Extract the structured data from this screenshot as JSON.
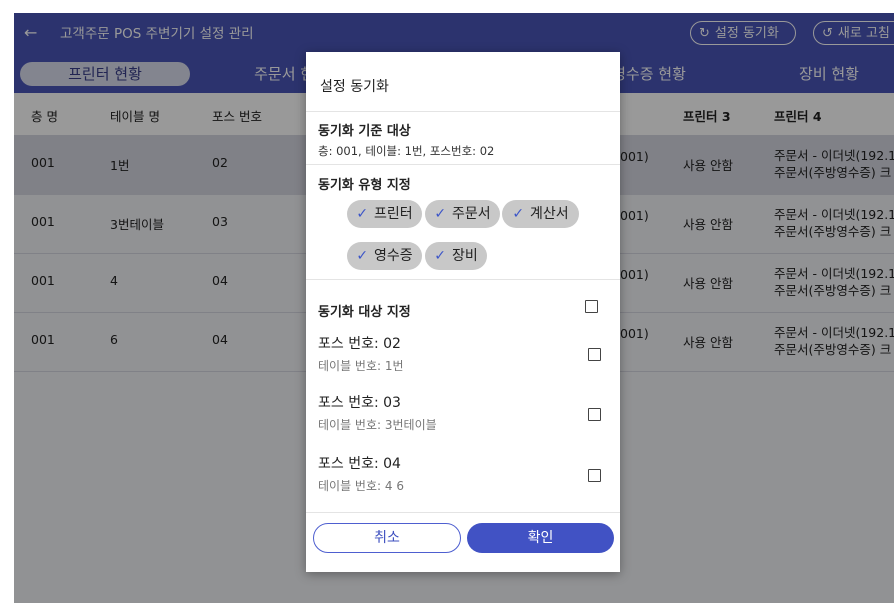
{
  "header": {
    "back_icon": "back-arrow-icon",
    "title": "고객주문 POS 주변기기 설정 관리",
    "sync_button": {
      "icon": "sync-icon",
      "label": "설정 동기화"
    },
    "refresh_button": {
      "icon": "refresh-icon",
      "label": "새로 고침"
    }
  },
  "tabs": [
    "프린터 현황",
    "주문서 현황",
    "영수증 현황",
    "장비 현황"
  ],
  "table": {
    "columns": [
      "층 명",
      "테이블 명",
      "포스 번호",
      "프린터 3",
      "프린터 4"
    ],
    "rows": [
      {
        "floor": "001",
        "table": "1번",
        "pos": "02",
        "partial": "001)",
        "printer3": "사용 안함",
        "printer4_line1": "주문서 - 이더넷(192.1",
        "printer4_line2": "주문서(주방영수증) 크"
      },
      {
        "floor": "001",
        "table": "3번테이블",
        "pos": "03",
        "partial": "001)",
        "printer3": "사용 안함",
        "printer4_line1": "주문서 - 이더넷(192.1",
        "printer4_line2": "주문서(주방영수증) 크"
      },
      {
        "floor": "001",
        "table": "4",
        "pos": "04",
        "partial": "001)",
        "printer3": "사용 안함",
        "printer4_line1": "주문서 - 이더넷(192.1",
        "printer4_line2": "주문서(주방영수증) 크"
      },
      {
        "floor": "001",
        "table": "6",
        "pos": "04",
        "partial": "001)",
        "printer3": "사용 안함",
        "printer4_line1": "주문서 - 이더넷(192.1",
        "printer4_line2": "주문서(주방영수증) 크"
      }
    ]
  },
  "dialog": {
    "title": "설정 동기화",
    "basis": {
      "title": "동기화 기준 대상",
      "detail": "층: 001, 테이블: 1번, 포스번호: 02"
    },
    "types": {
      "title": "동기화 유형 지정",
      "chips": [
        "프린터",
        "주문서",
        "계산서",
        "영수증",
        "장비"
      ]
    },
    "targets": {
      "title": "동기화 대상 지정",
      "items": [
        {
          "title": "포스 번호: 02",
          "sub": "테이블 번호: 1번"
        },
        {
          "title": "포스 번호: 03",
          "sub": "테이블 번호: 3번테이블"
        },
        {
          "title": "포스 번호: 04",
          "sub": "테이블 번호: 4 6"
        }
      ]
    },
    "cancel_label": "취소",
    "confirm_label": "확인"
  }
}
